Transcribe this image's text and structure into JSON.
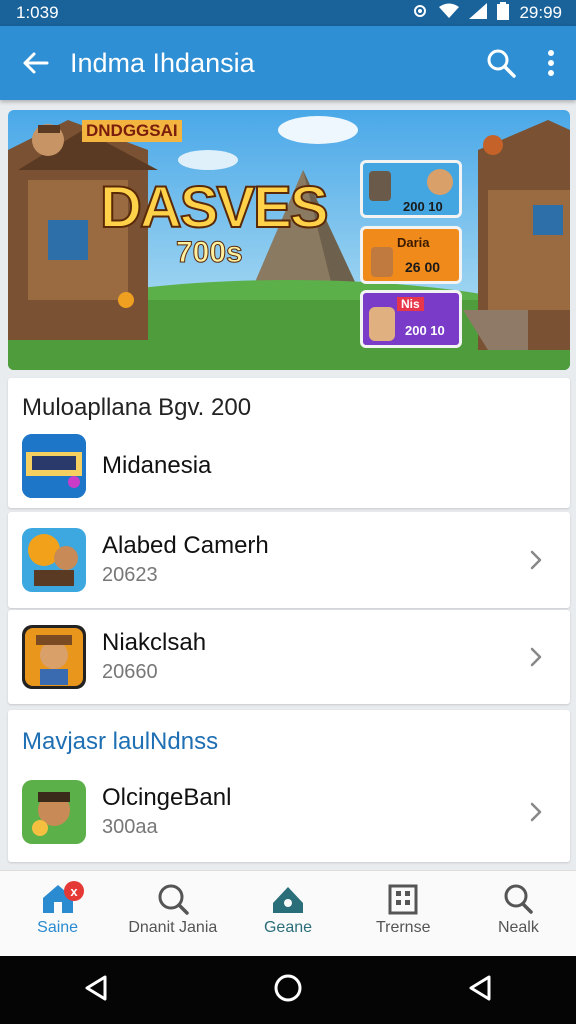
{
  "status_bar": {
    "time": "1:039",
    "clock_right": "29:99"
  },
  "app_bar": {
    "title": "Indma Ihdansia"
  },
  "banner": {
    "logo_text": "DNDGGSAI",
    "game_title": "DASVES",
    "game_subtitle": "700s",
    "cards": [
      {
        "value": "200 10",
        "color": "#43a6e0"
      },
      {
        "label": "Daria",
        "value": "26 00",
        "color": "#f08a1a"
      },
      {
        "label": "Nis",
        "value": "200 10",
        "color": "#7a3cc8"
      }
    ]
  },
  "section1": {
    "header": "Muloapllana Bgv. 200",
    "items": [
      {
        "name": "Midanesia",
        "sub": ""
      },
      {
        "name": "Alabed Camerh",
        "sub": "20623"
      },
      {
        "name": "Niakclsah",
        "sub": "20660"
      }
    ]
  },
  "section2": {
    "header": "Mavjasr laulNdnss",
    "items": [
      {
        "name": "OlcingeBanl",
        "sub": "300aa"
      }
    ]
  },
  "bottom_nav": {
    "items": [
      {
        "label": "Saine",
        "icon": "home-icon",
        "badge": "x"
      },
      {
        "label": "Dnanit Jania",
        "icon": "search-icon"
      },
      {
        "label": "Geane",
        "icon": "home-icon"
      },
      {
        "label": "Trernse",
        "icon": "building-icon"
      },
      {
        "label": "Nealk",
        "icon": "search-icon"
      }
    ]
  },
  "colors": {
    "app_bar": "#2e8fd4",
    "status_bar": "#19629a",
    "accent": "#2a8bd0",
    "section2_header": "#1e6fb3"
  }
}
